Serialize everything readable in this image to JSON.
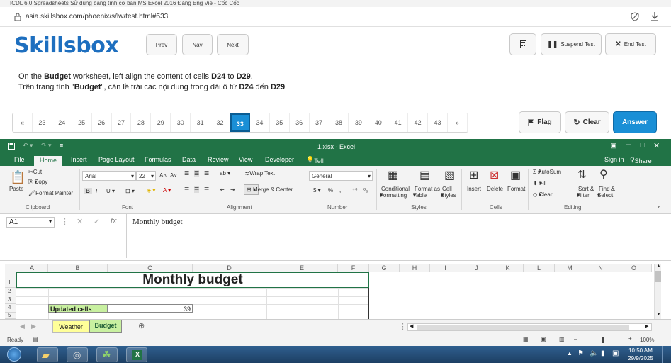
{
  "window_title": "ICDL 6.0 Spreadsheets Sử dụng bảng tính cơ bản MS Excel 2016 Đăng Eng Vie - Cốc Cốc",
  "address": {
    "url": "asia.skillsbox.com/phoenix/s/lw/test.html#533"
  },
  "skillsbox": {
    "logo": "Skillsbox",
    "prev": "Prev",
    "nav": "Nav",
    "next": "Next",
    "suspend": "Suspend Test",
    "end": "End Test",
    "question_line1_prefix": "On the ",
    "question_line1_b1": "Budget",
    "question_line1_mid": " worksheet, left align the content of cells ",
    "question_line1_b2": "D24",
    "question_line1_to": " to ",
    "question_line1_b3": "D29",
    "question_line1_end": ".",
    "question_line2_prefix": "Trên trang tính \"",
    "question_line2_b1": "Budget",
    "question_line2_mid": "\", căn lề trái các nội dung trong dải ô từ ",
    "question_line2_b2": "D24",
    "question_line2_to": " đến ",
    "question_line2_b3": "D29",
    "pager": [
      "«",
      "23",
      "24",
      "25",
      "26",
      "27",
      "28",
      "29",
      "30",
      "31",
      "32",
      "33",
      "34",
      "35",
      "36",
      "37",
      "38",
      "39",
      "40",
      "41",
      "42",
      "43",
      "»"
    ],
    "current_page": "33",
    "flag": "Flag",
    "clear": "Clear",
    "answer": "Answer"
  },
  "excel": {
    "file_title": "1.xlsx - Excel",
    "tabs": [
      "File",
      "Home",
      "Insert",
      "Page Layout",
      "Formulas",
      "Data",
      "Review",
      "View",
      "Developer"
    ],
    "tell_me": "Tell me what you want to do...",
    "sign_in": "Sign in",
    "share": "Share",
    "ribbon": {
      "cut": "Cut",
      "copy": "Copy",
      "paste": "Paste",
      "format_painter": "Format Painter",
      "font_name": "Arial",
      "font_size": "22",
      "wrap_text": "Wrap Text",
      "merge_center": "Merge & Center",
      "number_format": "General",
      "conditional": "Conditional",
      "formatting": "Formatting",
      "format_as": "Format as",
      "table": "Table",
      "cell": "Cell",
      "styles_lbl": "Styles",
      "insert": "Insert",
      "delete": "Delete",
      "format": "Format",
      "autosum": "AutoSum",
      "fill": "Fill",
      "clear": "Clear",
      "sort": "Sort &",
      "filter": "Filter",
      "find": "Find &",
      "select": "Select",
      "groups": [
        "Clipboard",
        "Font",
        "Alignment",
        "Number",
        "Styles",
        "Cells",
        "Editing"
      ]
    },
    "name_box": "A1",
    "formula": "Monthly budget",
    "columns": [
      "A",
      "B",
      "C",
      "D",
      "E",
      "F",
      "G",
      "H",
      "I",
      "J",
      "K",
      "L",
      "M",
      "N",
      "O"
    ],
    "rows": [
      "1",
      "2",
      "3",
      "4",
      "5"
    ],
    "cells": {
      "title": "Monthly budget",
      "updated_label": "Updated cells",
      "updated_value": "39"
    },
    "sheets": [
      "Weather",
      "Budget"
    ],
    "active_sheet": "Budget",
    "status_ready": "Ready",
    "zoom": "100%"
  },
  "taskbar": {
    "time": "10:50 AM",
    "date": "29/9/2025"
  }
}
